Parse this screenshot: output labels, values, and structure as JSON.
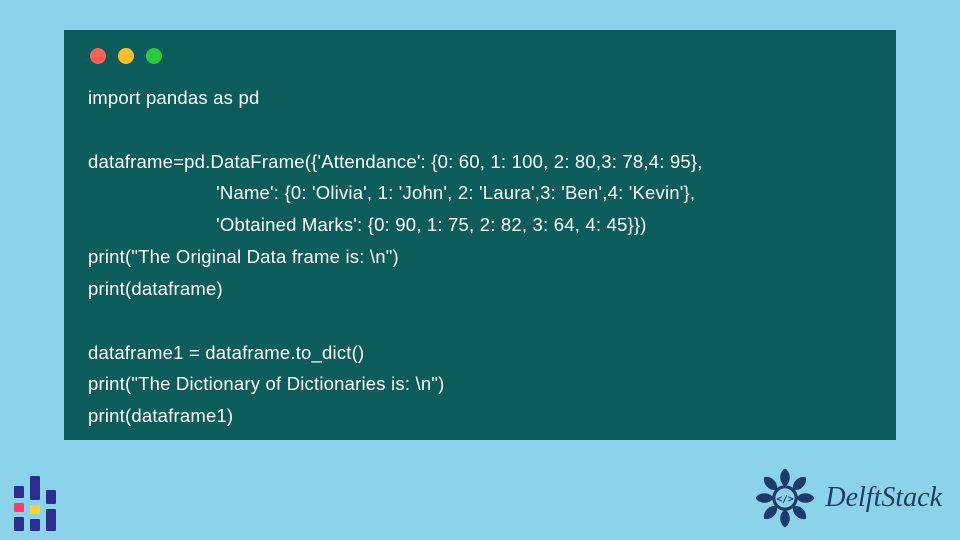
{
  "window": {
    "traffic_colors": {
      "red": "#ff5f56",
      "yellow": "#ffbd2e",
      "green": "#27c93f"
    },
    "bg": "#0d5c5c"
  },
  "code": {
    "l1": "import pandas as pd",
    "l2": "",
    "l3": "dataframe=pd.DataFrame({'Attendance': {0: 60, 1: 100, 2: 80,3: 78,4: 95},",
    "l4": "                        'Name': {0: 'Olivia', 1: 'John', 2: 'Laura',3: 'Ben',4: 'Kevin'},",
    "l5": "                        'Obtained Marks': {0: 90, 1: 75, 2: 82, 3: 64, 4: 45}})",
    "l6": "print(\"The Original Data frame is: \\n\")",
    "l7": "print(dataframe)",
    "l8": "",
    "l9": "dataframe1 = dataframe.to_dict()",
    "l10": "print(\"The Dictionary of Dictionaries is: \\n\")",
    "l11": "print(dataframe1)"
  },
  "brand": {
    "name": "DelftStack",
    "color": "#1b3b6a"
  },
  "logos": {
    "left_bars": {
      "c1": "#2d2f8f",
      "c2": "#2d2f8f",
      "c3": "#2d2f8f",
      "accent1": "#ff3b6b",
      "accent2": "#ffd23a"
    }
  }
}
